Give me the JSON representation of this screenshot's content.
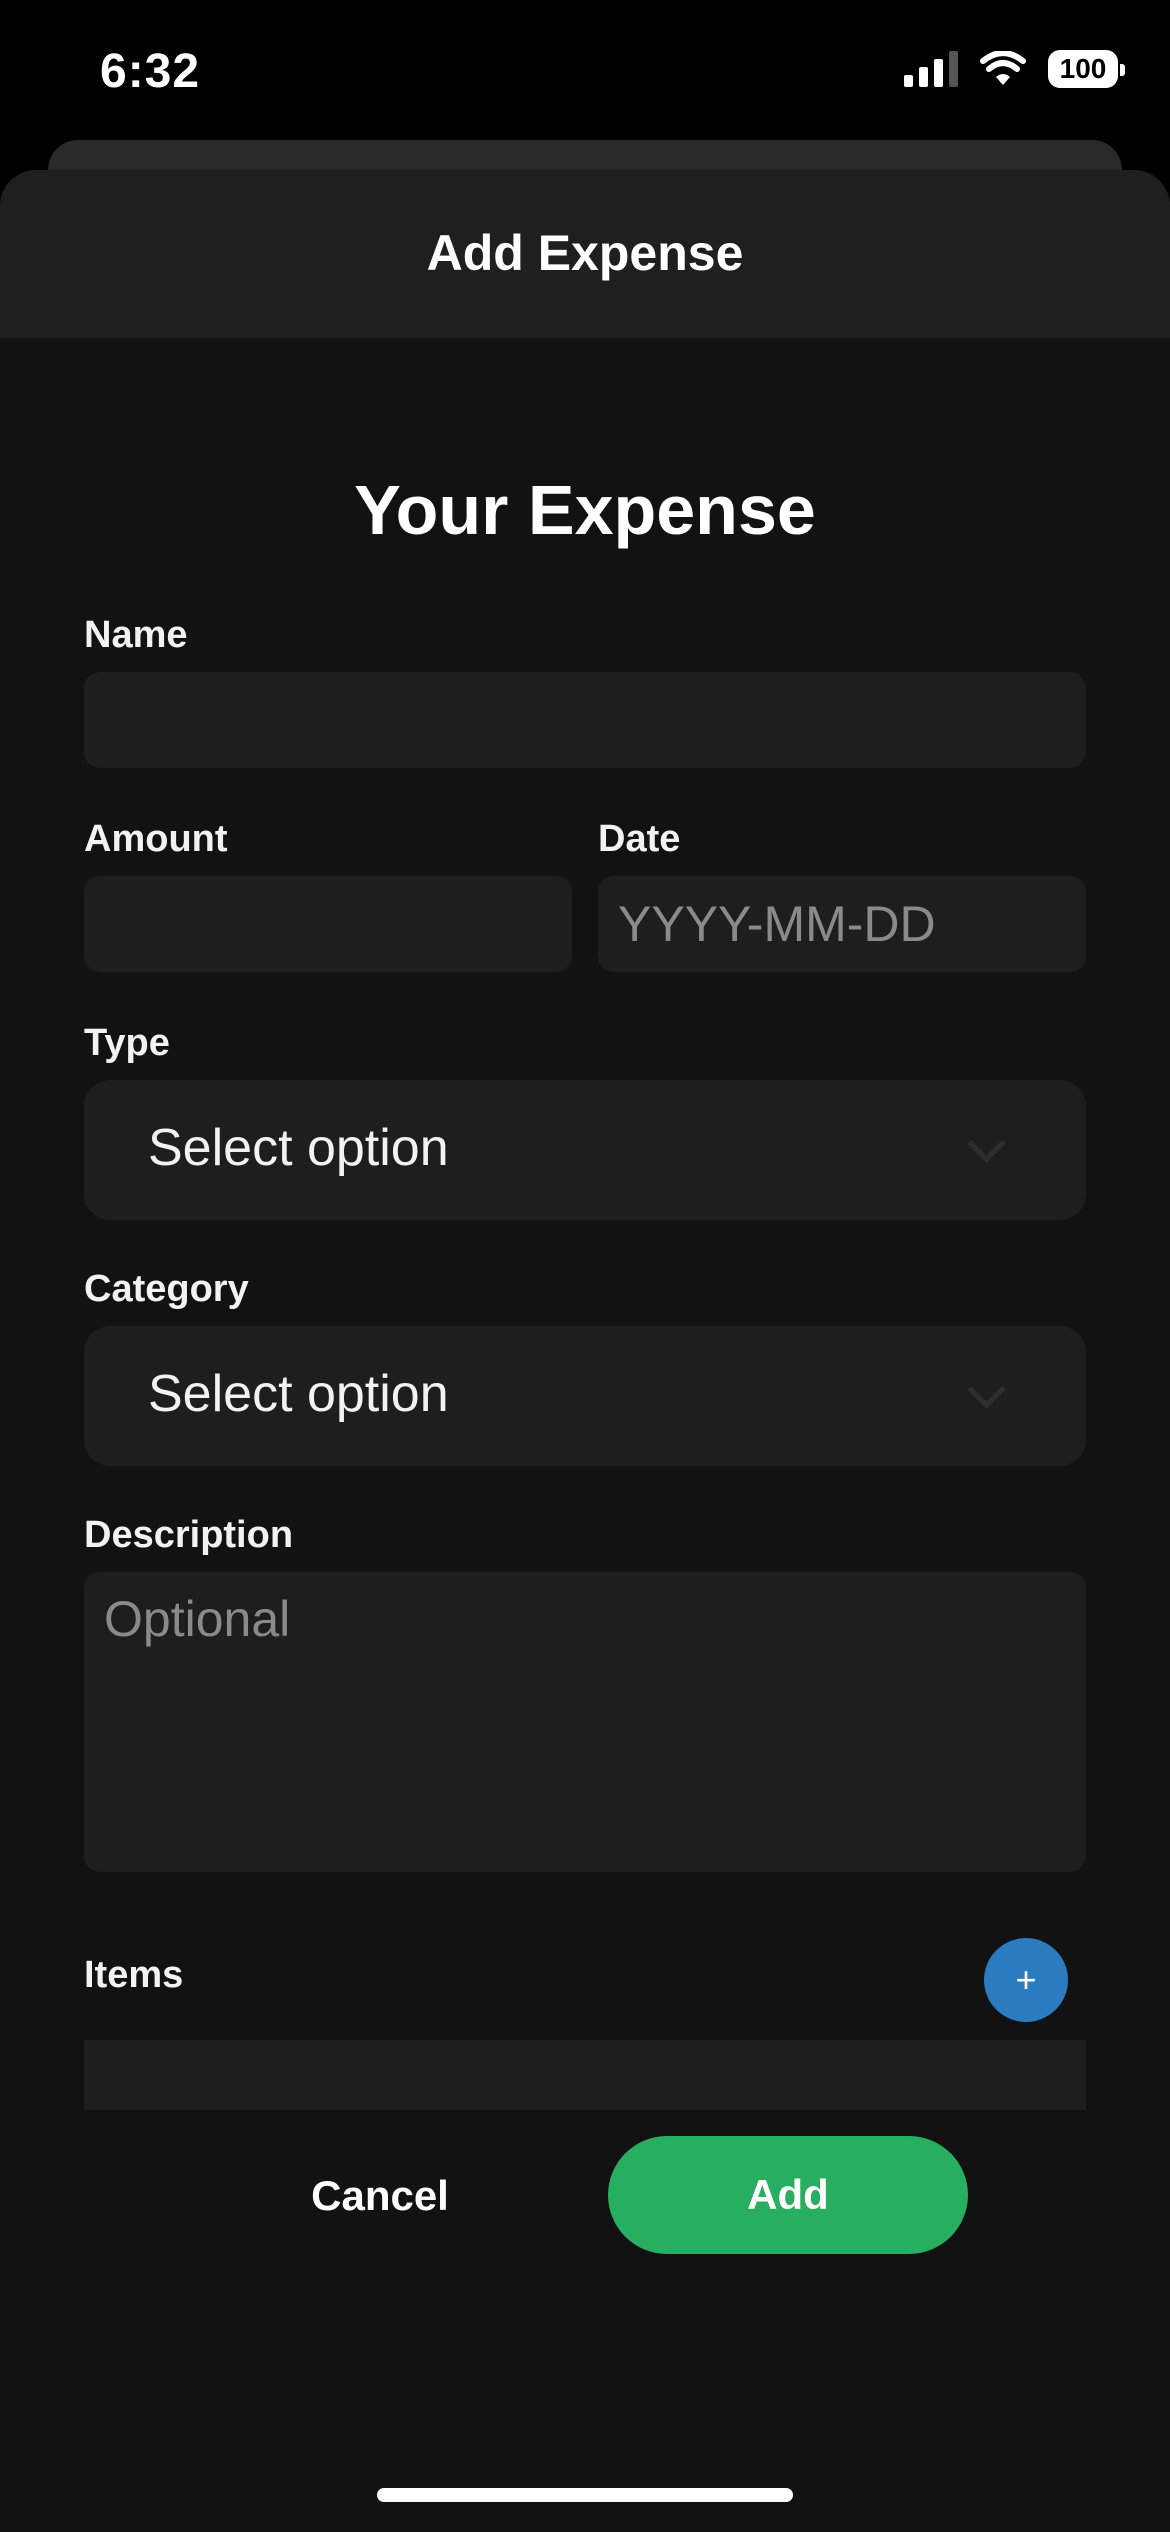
{
  "status_bar": {
    "time": "6:32",
    "battery": "100",
    "icons": [
      "signal-icon",
      "wifi-icon",
      "battery-icon"
    ]
  },
  "sheet": {
    "title": "Add Expense"
  },
  "form": {
    "heading": "Your Expense",
    "name": {
      "label": "Name",
      "value": "",
      "placeholder": ""
    },
    "amount": {
      "label": "Amount",
      "value": "",
      "placeholder": ""
    },
    "date": {
      "label": "Date",
      "value": "",
      "placeholder": "YYYY-MM-DD"
    },
    "type": {
      "label": "Type",
      "selected": "Select option"
    },
    "category": {
      "label": "Category",
      "selected": "Select option"
    },
    "description": {
      "label": "Description",
      "value": "",
      "placeholder": "Optional"
    },
    "items": {
      "label": "Items",
      "add_symbol": "+"
    }
  },
  "actions": {
    "cancel_label": "Cancel",
    "add_label": "Add"
  },
  "colors": {
    "background": "#121212",
    "header": "#1f1f1f",
    "field": "#1e1e1e",
    "accent_green": "#27ae60",
    "accent_blue": "#2a7bbf"
  }
}
